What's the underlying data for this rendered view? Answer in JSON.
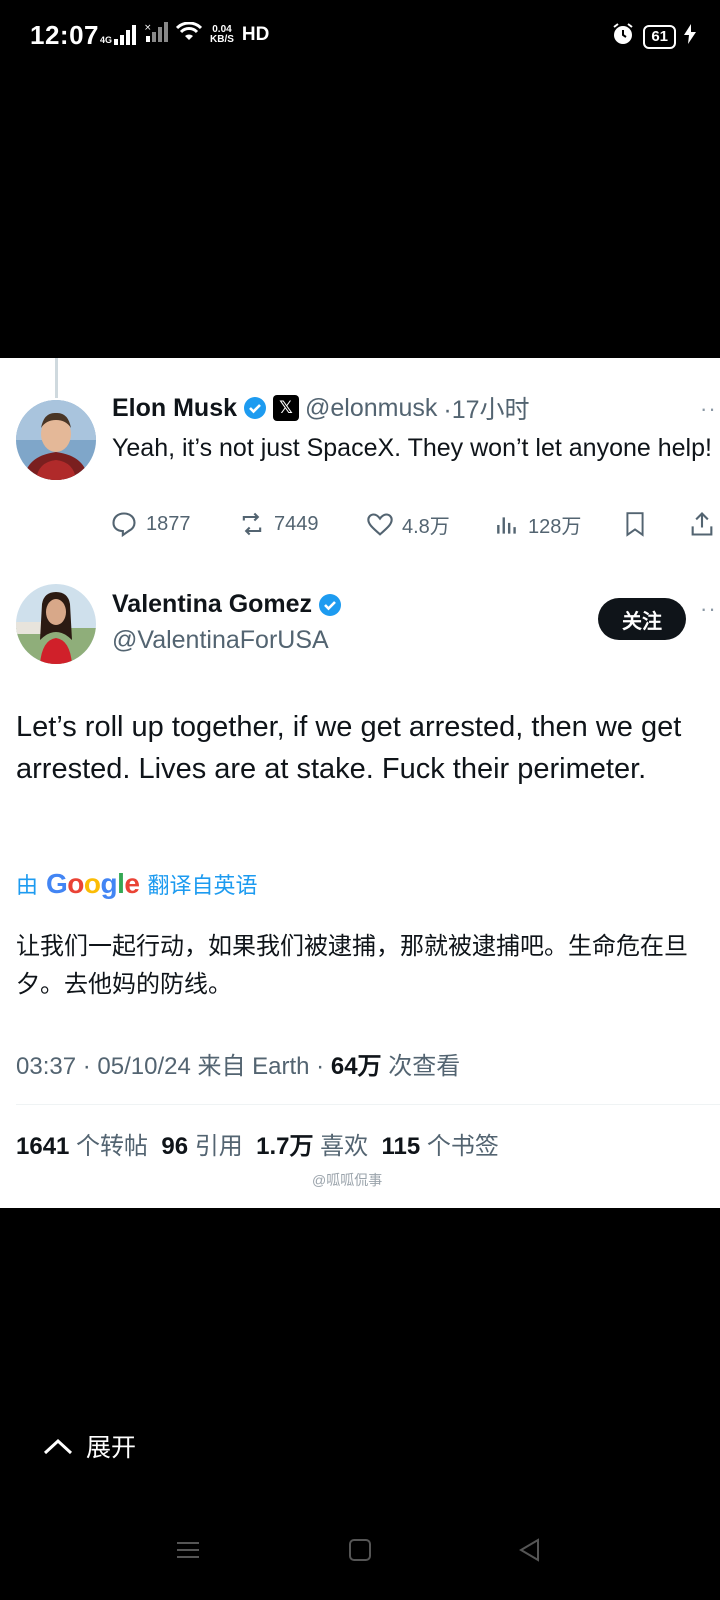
{
  "status_bar": {
    "time": "12:07",
    "network": "4G",
    "speed_value": "0.04",
    "speed_unit": "KB/S",
    "hd": "HD",
    "battery": "61"
  },
  "reply_tweet": {
    "name": "Elon Musk",
    "handle": "@elonmusk",
    "time": "·17小时",
    "text": "Yeah, it’s not just SpaceX. They won’t let anyone help!",
    "replies": "1877",
    "reposts": "7449",
    "likes": "4.8万",
    "views": "128万"
  },
  "main_tweet": {
    "name": "Valentina Gomez",
    "handle": "@ValentinaForUSA",
    "follow_label": "关注",
    "text": "Let’s roll up together, if we get arrested, then we get arrested. Lives are at stake. Fuck their perimeter.",
    "translate_prefix": "由",
    "translate_brand": "Google",
    "translate_suffix": "翻译自英语",
    "translated_text": "让我们一起行动，如果我们被逮捕，那就被逮捕吧。生命危在旦夕。去他妈的防线。",
    "meta_time": "03:37 · 05/10/24 来自 Earth · ",
    "meta_views": "64万",
    "meta_views_label": " 次查看",
    "stats": {
      "reposts_num": "1641",
      "reposts_label": " 个转帖",
      "quotes_num": "96",
      "quotes_label": " 引用",
      "likes_num": "1.7万",
      "likes_label": " 喜欢",
      "bookmarks_num": "115",
      "bookmarks_label": " 个书签"
    }
  },
  "watermark": "@呱呱侃事",
  "expand_label": "展开",
  "colors": {
    "verified": "#1d9bf0",
    "text": "#0f1419",
    "secondary": "#536471"
  }
}
